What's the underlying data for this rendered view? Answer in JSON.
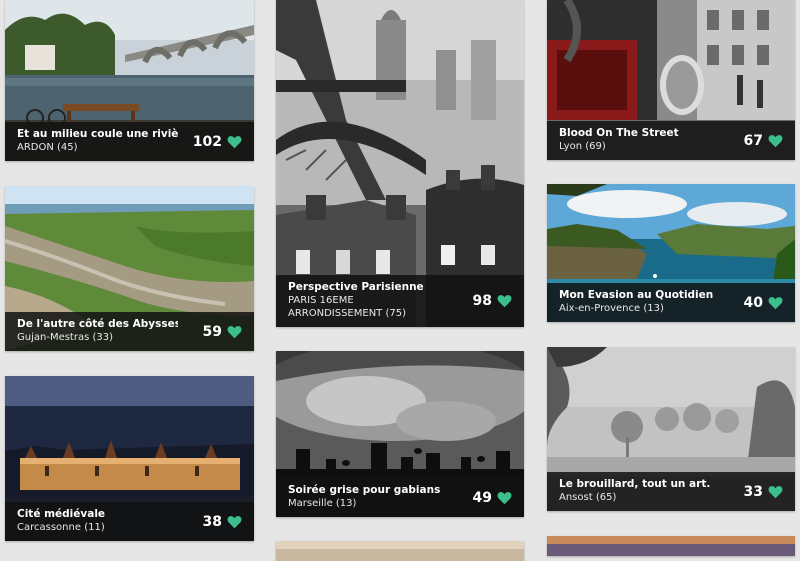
{
  "colors": {
    "accent": "#3cbf8c",
    "caption_bg": "#121212",
    "page_bg": "#e6e6e6"
  },
  "icons": {
    "like": "heart-icon"
  },
  "cards": [
    {
      "title": "Et au milieu coule une rivière",
      "place": "ARDON",
      "count": "(45)",
      "likes": "102"
    },
    {
      "title": "De l'autre côté des Abysses",
      "place": "Gujan-Mestras",
      "count": "(33)",
      "likes": "59"
    },
    {
      "title": "Cité médiévale",
      "place": "Carcassonne",
      "count": "(11)",
      "likes": "38"
    },
    {
      "title": "Perspective Parisienne",
      "place": "PARIS 16EME ARRONDISSEMENT",
      "count": "(75)",
      "likes": "98"
    },
    {
      "title": "Soirée grise pour gabians",
      "place": "Marseille",
      "count": "(13)",
      "likes": "49"
    },
    {
      "title": "Blood On The Street",
      "place": "Lyon",
      "count": "(69)",
      "likes": "67"
    },
    {
      "title": "Mon Evasion au Quotidien",
      "place": "Aix-en-Provence",
      "count": "(13)",
      "likes": "40"
    },
    {
      "title": "Le brouillard, tout un art.",
      "place": "Ansost",
      "count": "(65)",
      "likes": "33"
    }
  ]
}
